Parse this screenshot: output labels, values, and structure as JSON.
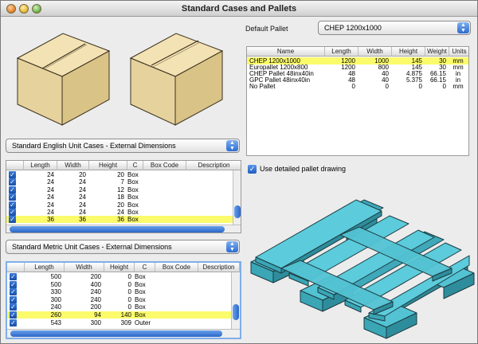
{
  "window": {
    "title": "Standard Cases and Pallets"
  },
  "default_pallet": {
    "label": "Default Pallet",
    "selected": "CHEP 1200x1000"
  },
  "pallet_table": {
    "columns": [
      "Name",
      "Length",
      "Width",
      "Height",
      "Weight",
      "Units"
    ],
    "rows": [
      {
        "name": "CHEP 1200x1000",
        "length": "1200",
        "width": "1000",
        "height": "145",
        "weight": "30",
        "units": "mm",
        "selected": true
      },
      {
        "name": "Europallet 1200x800",
        "length": "1200",
        "width": "800",
        "height": "145",
        "weight": "30",
        "units": "mm",
        "selected": false
      },
      {
        "name": "CHEP Pallet 48inx40in",
        "length": "48",
        "width": "40",
        "height": "4.875",
        "weight": "66.15",
        "units": "in",
        "selected": false
      },
      {
        "name": "GPC Pallet 48inx40in",
        "length": "48",
        "width": "40",
        "height": "5.375",
        "weight": "66.15",
        "units": "in",
        "selected": false
      },
      {
        "name": "No Pallet",
        "length": "0",
        "width": "0",
        "height": "0",
        "weight": "0",
        "units": "mm",
        "selected": false
      }
    ]
  },
  "english_cases": {
    "popup": "Standard English Unit Cases - External Dimensions",
    "columns": [
      "",
      "Length",
      "Width",
      "Height",
      "C",
      "Box Code",
      "Description"
    ],
    "rows": [
      {
        "checked": true,
        "length": "24",
        "width": "20",
        "height": "20",
        "c": "Box",
        "selected": false
      },
      {
        "checked": true,
        "length": "24",
        "width": "24",
        "height": "7",
        "c": "Box",
        "selected": false
      },
      {
        "checked": true,
        "length": "24",
        "width": "24",
        "height": "12",
        "c": "Box",
        "selected": false
      },
      {
        "checked": true,
        "length": "24",
        "width": "24",
        "height": "18",
        "c": "Box",
        "selected": false
      },
      {
        "checked": true,
        "length": "24",
        "width": "24",
        "height": "20",
        "c": "Box",
        "selected": false
      },
      {
        "checked": true,
        "length": "24",
        "width": "24",
        "height": "24",
        "c": "Box",
        "selected": false
      },
      {
        "checked": true,
        "length": "36",
        "width": "36",
        "height": "36",
        "c": "Box",
        "selected": true
      }
    ]
  },
  "metric_cases": {
    "popup": "Standard Metric Unit Cases - External Dimensions",
    "columns": [
      "",
      "Length",
      "Width",
      "Height",
      "C",
      "Box Code",
      "Description"
    ],
    "rows": [
      {
        "checked": true,
        "length": "500",
        "width": "200",
        "height": "0",
        "c": "Box",
        "selected": false
      },
      {
        "checked": true,
        "length": "500",
        "width": "400",
        "height": "0",
        "c": "Box",
        "selected": false
      },
      {
        "checked": true,
        "length": "330",
        "width": "240",
        "height": "0",
        "c": "Box",
        "selected": false
      },
      {
        "checked": true,
        "length": "300",
        "width": "240",
        "height": "0",
        "c": "Box",
        "selected": false
      },
      {
        "checked": true,
        "length": "240",
        "width": "200",
        "height": "0",
        "c": "Box",
        "selected": false
      },
      {
        "checked": true,
        "length": "260",
        "width": "94",
        "height": "140",
        "c": "Box",
        "selected": true
      },
      {
        "checked": true,
        "length": "543",
        "width": "300",
        "height": "309",
        "c": "Outer",
        "selected": false
      }
    ]
  },
  "detailed_drawing": {
    "label": "Use detailed pallet drawing",
    "checked": true
  },
  "colors": {
    "selection": "#fbfb6c",
    "box": "#efdcaa",
    "pallet": "#53c3d3",
    "accent": "#2d6cd0"
  }
}
